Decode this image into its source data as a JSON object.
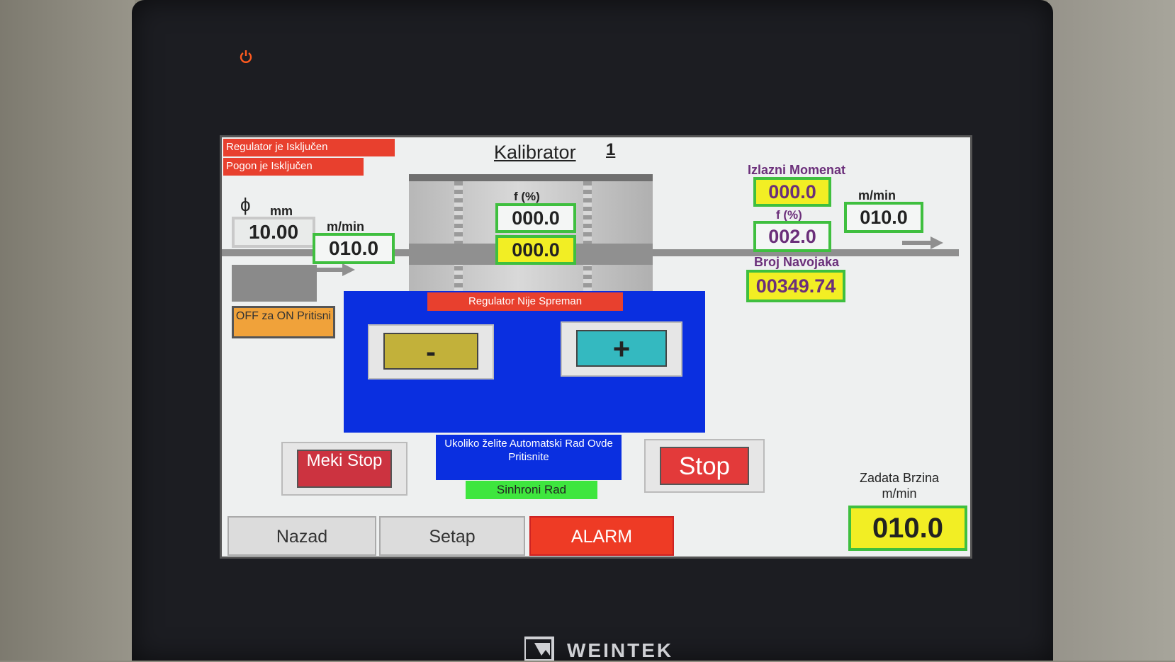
{
  "screen": {
    "title": "Kalibrator",
    "title_number": "1"
  },
  "messages": {
    "regulator_off": "Regulator je Isključen",
    "drive_off": "Pogon je Isključen"
  },
  "inlet": {
    "diameter_symbol": "ϕ",
    "diameter_unit": "mm",
    "diameter_value": "10.00",
    "speed_unit": "m/min",
    "speed_value": "010.0",
    "onoff_button": "OFF za ON Pritisni"
  },
  "center": {
    "freq_label": "f (%)",
    "freq_value": "000.0",
    "freq_setpoint": "000.0",
    "regulator_status": "Regulator Nije Spreman",
    "minus_button": "-",
    "plus_button": "+"
  },
  "outlet": {
    "torque_label": "Izlazni Momenat",
    "torque_value": "000.0",
    "freq_label": "f (%)",
    "freq_value": "002.0",
    "speed_unit": "m/min",
    "speed_value": "010.0",
    "turns_label": "Broj Navojaka",
    "turns_value": "00349.74"
  },
  "controls": {
    "soft_stop_button": "Meki Stop",
    "stop_button": "Stop",
    "auto_mode_text": "Ukoliko želite Automatski Rad Ovde Pritisnite",
    "sync_mode": "Sinhroni Rad"
  },
  "tabs": {
    "back": "Nazad",
    "setup": "Setap",
    "alarm": "ALARM"
  },
  "setpoint": {
    "label": "Zadata Brzina",
    "unit": "m/min",
    "value": "010.0"
  },
  "device": {
    "brand": "WEINTEK",
    "power_icon": "power-icon"
  },
  "colors": {
    "alarm_red": "#e8402e",
    "panel_blue": "#0a2fe0",
    "value_yellow": "#f2ee24",
    "frame_green": "#3fbf3f"
  }
}
